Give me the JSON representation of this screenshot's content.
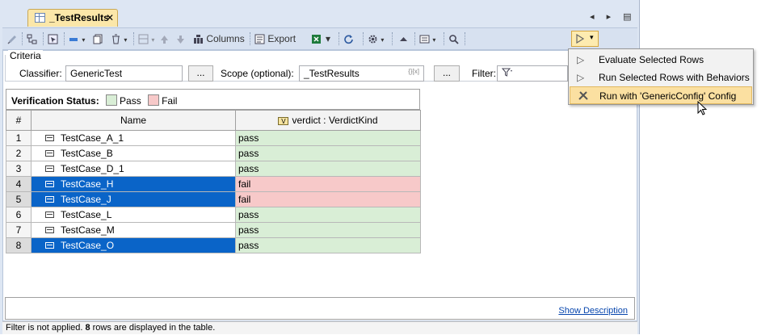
{
  "tab": {
    "title": "_TestResults",
    "close": "✕"
  },
  "tab_nav": "◂ ▸ ▤",
  "toolbar": {
    "columns_label": "Columns",
    "export_label": "Export"
  },
  "criteria": {
    "legend": "Criteria",
    "classifier_label": "Classifier:",
    "classifier_value": "GenericTest",
    "ellipsis": "...",
    "scope_label": "Scope (optional):",
    "scope_value": "_TestResults",
    "scope_hint": "{}[x]",
    "filter_label": "Filter:"
  },
  "verification": {
    "label": "Verification Status:",
    "pass": "Pass",
    "fail": "Fail"
  },
  "colors": {
    "pass": "#d9eed6",
    "fail": "#f7c9c9",
    "selected": "#0a64c8",
    "menu_highlight": "#fbe0a1"
  },
  "table": {
    "columns": [
      "#",
      "Name",
      "verdict : VerdictKind"
    ],
    "verdict_icon_letter": "V",
    "rows": [
      {
        "num": "1",
        "name": "TestCase_A_1",
        "verdict": "pass",
        "selected": false
      },
      {
        "num": "2",
        "name": "TestCase_B",
        "verdict": "pass",
        "selected": false
      },
      {
        "num": "3",
        "name": "TestCase_D_1",
        "verdict": "pass",
        "selected": false
      },
      {
        "num": "4",
        "name": "TestCase_H",
        "verdict": "fail",
        "selected": true
      },
      {
        "num": "5",
        "name": "TestCase_J",
        "verdict": "fail",
        "selected": true
      },
      {
        "num": "6",
        "name": "TestCase_L",
        "verdict": "pass",
        "selected": false
      },
      {
        "num": "7",
        "name": "TestCase_M",
        "verdict": "pass",
        "selected": false
      },
      {
        "num": "8",
        "name": "TestCase_O",
        "verdict": "pass",
        "selected": true
      }
    ]
  },
  "description": {
    "link": "Show Description"
  },
  "status": {
    "prefix": "Filter is not applied. ",
    "count": "8",
    "suffix": " rows are displayed in the table."
  },
  "menu": {
    "items": [
      {
        "label": "Evaluate Selected Rows",
        "icon": "play-icon"
      },
      {
        "label": "Run Selected Rows with Behaviors",
        "icon": "play-icon"
      },
      {
        "label": "Run with 'GenericConfig' Config",
        "icon": "tools-icon"
      }
    ]
  }
}
